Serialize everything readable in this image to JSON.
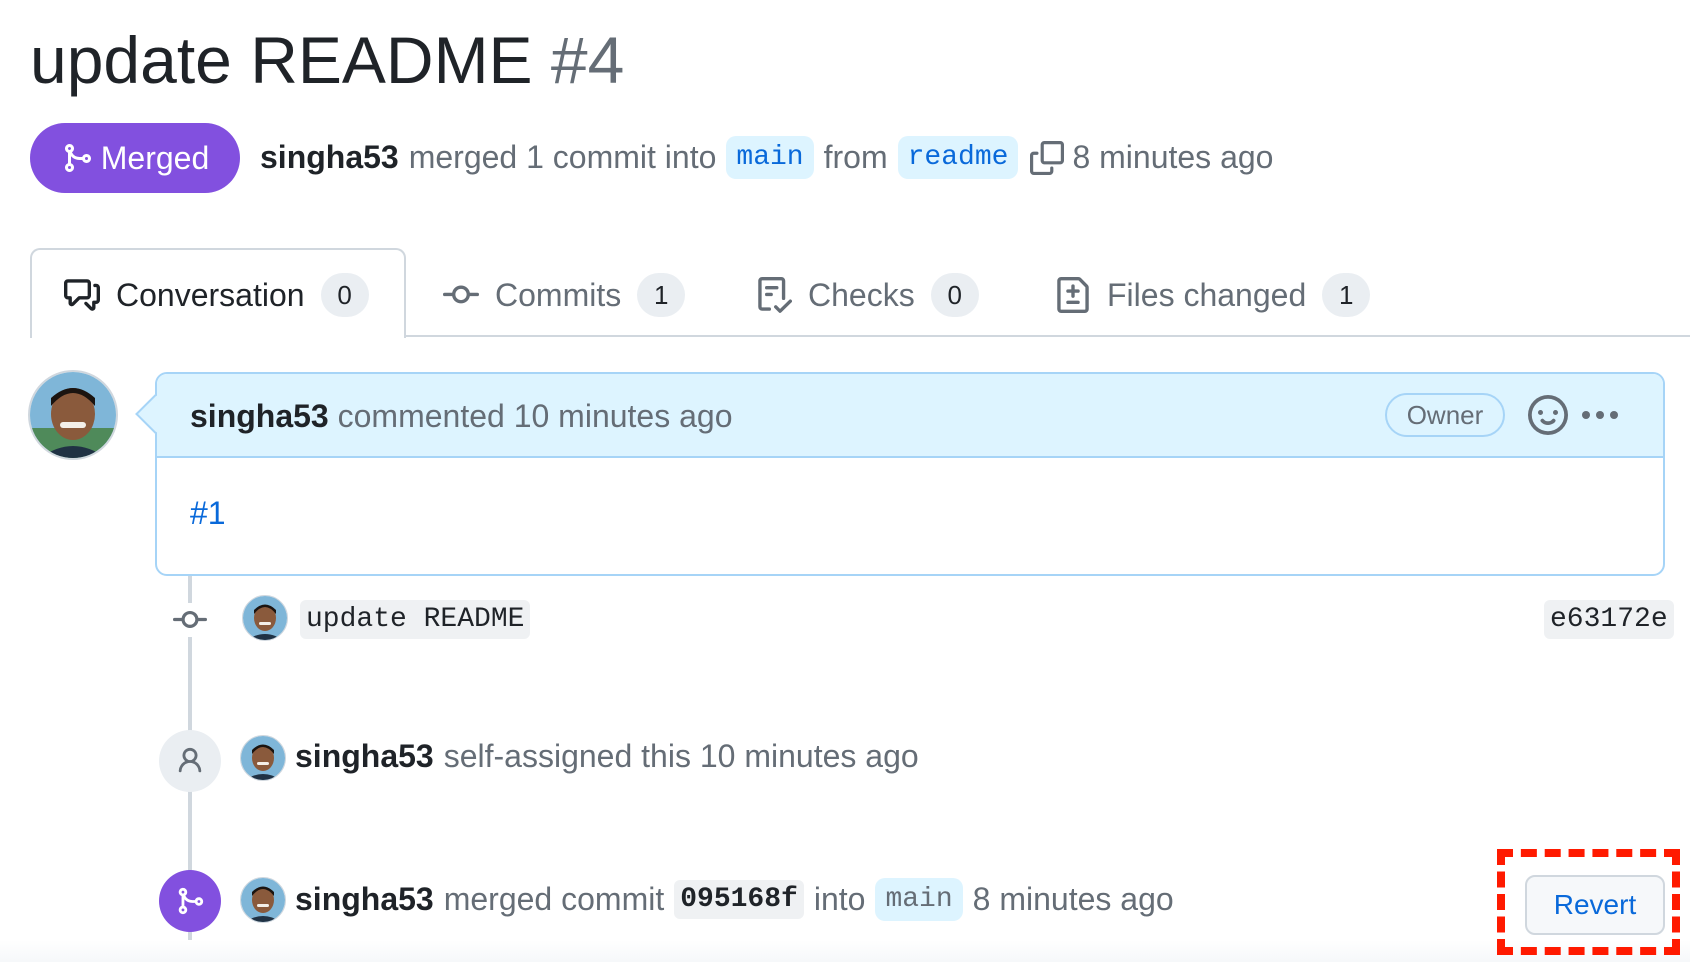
{
  "pr": {
    "title": "update README",
    "number": "#4",
    "status": "Merged",
    "author": "singha53",
    "merge_text": "merged 1 commit into",
    "base_branch": "main",
    "from_text": "from",
    "head_branch": "readme",
    "time": "8 minutes ago"
  },
  "tabs": [
    {
      "label": "Conversation",
      "count": "0",
      "icon": "comment-discussion-icon"
    },
    {
      "label": "Commits",
      "count": "1",
      "icon": "git-commit-icon"
    },
    {
      "label": "Checks",
      "count": "0",
      "icon": "checklist-icon"
    },
    {
      "label": "Files changed",
      "count": "1",
      "icon": "file-diff-icon"
    }
  ],
  "comment": {
    "author": "singha53",
    "action": "commented 10 minutes ago",
    "role_badge": "Owner",
    "body_link": "#1"
  },
  "timeline": {
    "commit": {
      "message": "update README",
      "sha": "e63172e"
    },
    "assign": {
      "user": "singha53",
      "text": "self-assigned this 10 minutes ago"
    },
    "merge": {
      "user": "singha53",
      "text_before": "merged commit",
      "sha": "095168f",
      "text_into": "into",
      "branch": "main",
      "time": "8 minutes ago",
      "revert_label": "Revert"
    }
  },
  "colors": {
    "merged_purple": "#8250df",
    "link_blue": "#0969da",
    "highlight_red": "#ff1a00",
    "comment_header_bg": "#ddf4ff"
  }
}
